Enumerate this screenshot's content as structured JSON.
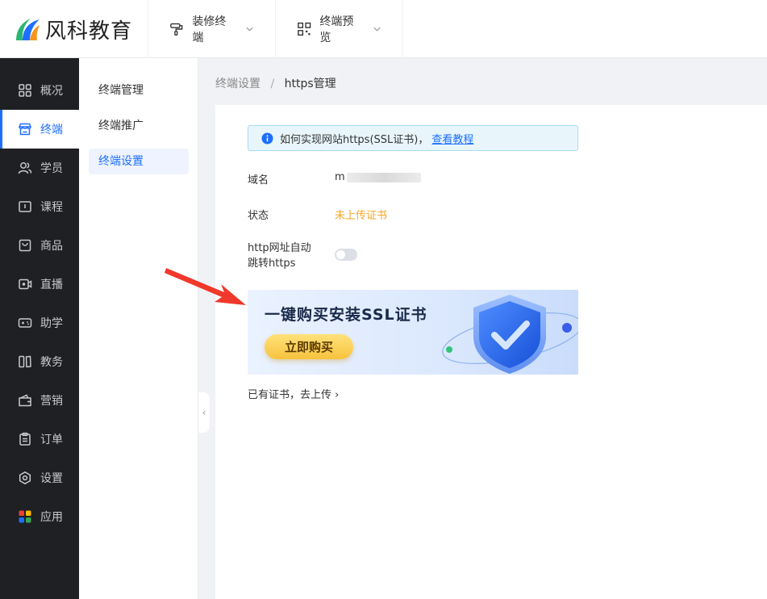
{
  "header": {
    "logo_text": "风科教育",
    "nav": [
      {
        "label": "装修终端"
      },
      {
        "label": "终端预览"
      }
    ]
  },
  "sidenav": {
    "items": [
      {
        "label": "概况",
        "icon": "grid-icon"
      },
      {
        "label": "终端",
        "icon": "store-icon"
      },
      {
        "label": "学员",
        "icon": "users-icon"
      },
      {
        "label": "课程",
        "icon": "course-icon"
      },
      {
        "label": "商品",
        "icon": "bag-icon"
      },
      {
        "label": "直播",
        "icon": "live-icon"
      },
      {
        "label": "助学",
        "icon": "gamepad-icon"
      },
      {
        "label": "教务",
        "icon": "book-icon"
      },
      {
        "label": "营销",
        "icon": "wallet-icon"
      },
      {
        "label": "订单",
        "icon": "clipboard-icon"
      },
      {
        "label": "设置",
        "icon": "gear-icon"
      },
      {
        "label": "应用",
        "icon": "apps-icon"
      }
    ],
    "active_index": 1,
    "accent_color": "#1e6fff"
  },
  "submenu": {
    "items": [
      {
        "label": "终端管理"
      },
      {
        "label": "终端推广"
      },
      {
        "label": "终端设置"
      }
    ],
    "active_index": 2
  },
  "breadcrumb": {
    "parent": "终端设置",
    "separator": "/",
    "current": "https管理"
  },
  "content": {
    "info": {
      "text": "如何实现网站https(SSL证书)，",
      "link": "查看教程"
    },
    "domain_label": "域名",
    "domain_value": "m",
    "status_label": "状态",
    "status_value": "未上传证书",
    "status_color": "#f5a623",
    "redirect_label_line1": "http网址自动",
    "redirect_label_line2": "跳转https",
    "redirect_enabled": false,
    "banner": {
      "title": "一键购买安装SSL证书",
      "button": "立即购买"
    },
    "upload_link": "已有证书，去上传 ›"
  }
}
